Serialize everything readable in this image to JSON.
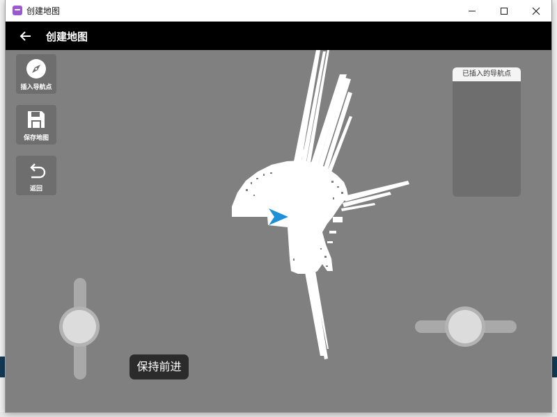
{
  "window": {
    "title": "创建地图"
  },
  "header": {
    "title": "创建地图"
  },
  "toolbar": {
    "insert_waypoint": "插入导航点",
    "save_map": "保存地图",
    "back": "返回"
  },
  "waypoints_panel": {
    "title": "已插入的导航点",
    "items": []
  },
  "toast": {
    "text": "保持前进"
  },
  "colors": {
    "map_bg": "#808080",
    "robot_arrow": "#1e90d8",
    "header": "#000000"
  },
  "icons": {
    "app": "app-icon",
    "minimize": "minimize-icon",
    "maximize": "maximize-icon",
    "close": "close-icon",
    "back": "arrow-left-icon",
    "insert_waypoint": "compass-icon",
    "save_map": "floppy-disk-icon",
    "return": "undo-icon"
  }
}
